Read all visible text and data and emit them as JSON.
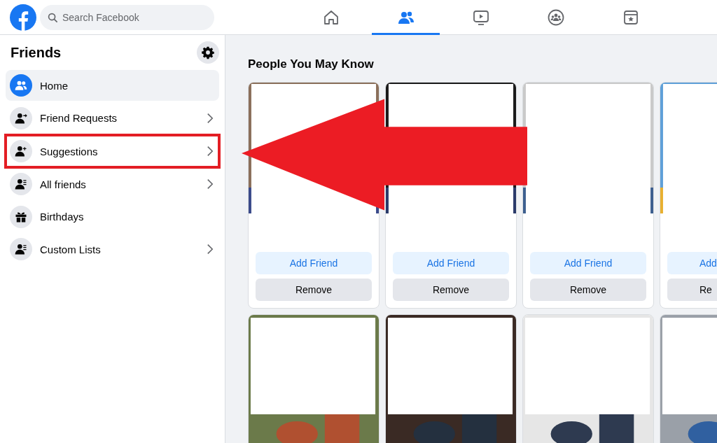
{
  "search": {
    "placeholder": "Search Facebook"
  },
  "nav_tabs": [
    {
      "selected": false
    },
    {
      "selected": true
    },
    {
      "selected": false
    },
    {
      "selected": false
    },
    {
      "selected": false
    }
  ],
  "sidebar": {
    "title": "Friends",
    "items": [
      {
        "label": "Home",
        "selected": true,
        "has_arrow": false,
        "highlighted": false
      },
      {
        "label": "Friend Requests",
        "selected": false,
        "has_arrow": true,
        "highlighted": false
      },
      {
        "label": "Suggestions",
        "selected": false,
        "has_arrow": true,
        "highlighted": true
      },
      {
        "label": "All friends",
        "selected": false,
        "has_arrow": true,
        "highlighted": false
      },
      {
        "label": "Birthdays",
        "selected": false,
        "has_arrow": false,
        "highlighted": false
      },
      {
        "label": "Custom Lists",
        "selected": false,
        "has_arrow": true,
        "highlighted": false
      }
    ]
  },
  "section_title": "People You May Know",
  "cards": [
    {
      "add_label": "Add Friend",
      "remove_label": "Remove",
      "cut": false
    },
    {
      "add_label": "Add Friend",
      "remove_label": "Remove",
      "cut": false
    },
    {
      "add_label": "Add Friend",
      "remove_label": "Remove",
      "cut": false
    },
    {
      "add_label": "Add",
      "remove_label": "Re",
      "cut": true
    }
  ],
  "annotations": [
    {
      "kind": "arrow"
    }
  ]
}
